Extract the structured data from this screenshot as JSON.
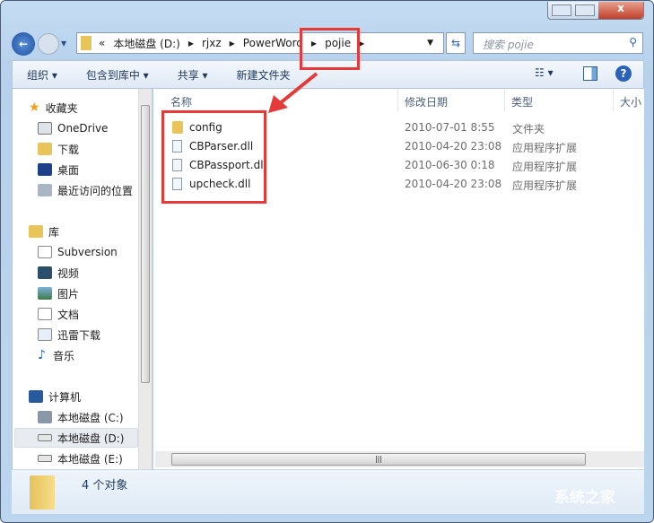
{
  "window": {
    "minimize_icon": "minimize-icon",
    "maximize_icon": "maximize-icon",
    "close_icon": "close-icon"
  },
  "address": {
    "overflow": "«",
    "crumbs": [
      "本地磁盘 (D:)",
      "rjxz",
      "PowerWord",
      "pojie"
    ]
  },
  "search": {
    "placeholder": "搜索 pojie"
  },
  "toolbar": {
    "organize": "组织 ▾",
    "include": "包含到库中 ▾",
    "share": "共享 ▾",
    "new_folder": "新建文件夹"
  },
  "nav": {
    "favorites": {
      "label": "收藏夹",
      "items": [
        "OneDrive",
        "下载",
        "桌面",
        "最近访问的位置"
      ]
    },
    "libraries": {
      "label": "库",
      "items": [
        "Subversion",
        "视频",
        "图片",
        "文档",
        "迅雷下载",
        "音乐"
      ]
    },
    "computer": {
      "label": "计算机",
      "items": [
        "本地磁盘 (C:)",
        "本地磁盘 (D:)",
        "本地磁盘 (E:)"
      ],
      "selected": "本地磁盘 (D:)"
    }
  },
  "columns": [
    "名称",
    "修改日期",
    "类型",
    "大小"
  ],
  "files": [
    {
      "name": "config",
      "date": "2010-07-01 8:55",
      "type": "文件夹",
      "icon": "folder-icon"
    },
    {
      "name": "CBParser.dll",
      "date": "2010-04-20 23:08",
      "type": "应用程序扩展",
      "icon": "dll-icon"
    },
    {
      "name": "CBPassport.dll",
      "date": "2010-06-30 0:18",
      "type": "应用程序扩展",
      "icon": "dll-icon"
    },
    {
      "name": "upcheck.dll",
      "date": "2010-04-20 23:08",
      "type": "应用程序扩展",
      "icon": "dll-icon"
    }
  ],
  "status": {
    "count": "4 个对象"
  },
  "watermark": "系统之家",
  "colors": {
    "highlight": "#e63a3a"
  }
}
